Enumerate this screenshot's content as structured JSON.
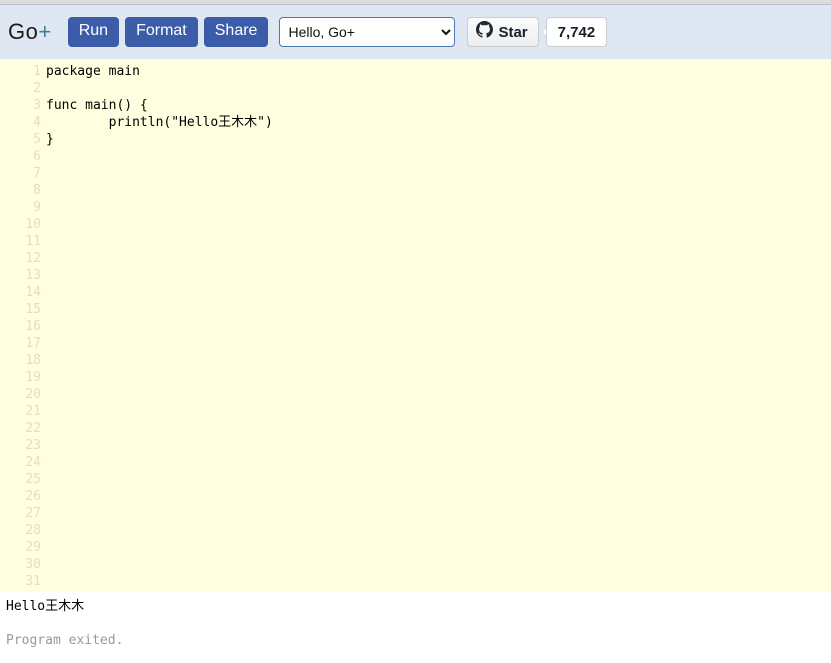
{
  "toolbar": {
    "logo_go": "Go",
    "logo_plus": "+",
    "run_label": "Run",
    "format_label": "Format",
    "share_label": "Share",
    "example_selected": "Hello, Go+",
    "example_options": [
      "Hello, Go+"
    ],
    "github_icon": "github-octocat-icon",
    "star_label": "Star",
    "star_count": "7,742",
    "dropdown_icon": "chevron-down-icon",
    "accent_color": "#3b5ca8",
    "header_bg": "#dfe7f3"
  },
  "editor": {
    "background": "#ffffe0",
    "line_number_color": "#e3e0b8",
    "total_lines": 31,
    "lines": [
      {
        "n": "1",
        "text": "package main"
      },
      {
        "n": "2",
        "text": ""
      },
      {
        "n": "3",
        "text": "func main() {"
      },
      {
        "n": "4",
        "text": "        println(\"Hello王木木\")"
      },
      {
        "n": "5",
        "text": "}"
      },
      {
        "n": "6",
        "text": ""
      },
      {
        "n": "7",
        "text": ""
      },
      {
        "n": "8",
        "text": ""
      },
      {
        "n": "9",
        "text": ""
      },
      {
        "n": "10",
        "text": ""
      },
      {
        "n": "11",
        "text": ""
      },
      {
        "n": "12",
        "text": ""
      },
      {
        "n": "13",
        "text": ""
      },
      {
        "n": "14",
        "text": ""
      },
      {
        "n": "15",
        "text": ""
      },
      {
        "n": "16",
        "text": ""
      },
      {
        "n": "17",
        "text": ""
      },
      {
        "n": "18",
        "text": ""
      },
      {
        "n": "19",
        "text": ""
      },
      {
        "n": "20",
        "text": ""
      },
      {
        "n": "21",
        "text": ""
      },
      {
        "n": "22",
        "text": ""
      },
      {
        "n": "23",
        "text": ""
      },
      {
        "n": "24",
        "text": ""
      },
      {
        "n": "25",
        "text": ""
      },
      {
        "n": "26",
        "text": ""
      },
      {
        "n": "27",
        "text": ""
      },
      {
        "n": "28",
        "text": ""
      },
      {
        "n": "29",
        "text": ""
      },
      {
        "n": "30",
        "text": ""
      },
      {
        "n": "31",
        "text": ""
      }
    ]
  },
  "output": {
    "result": "Hello王木木",
    "status": "Program exited.",
    "status_color": "#999999"
  }
}
